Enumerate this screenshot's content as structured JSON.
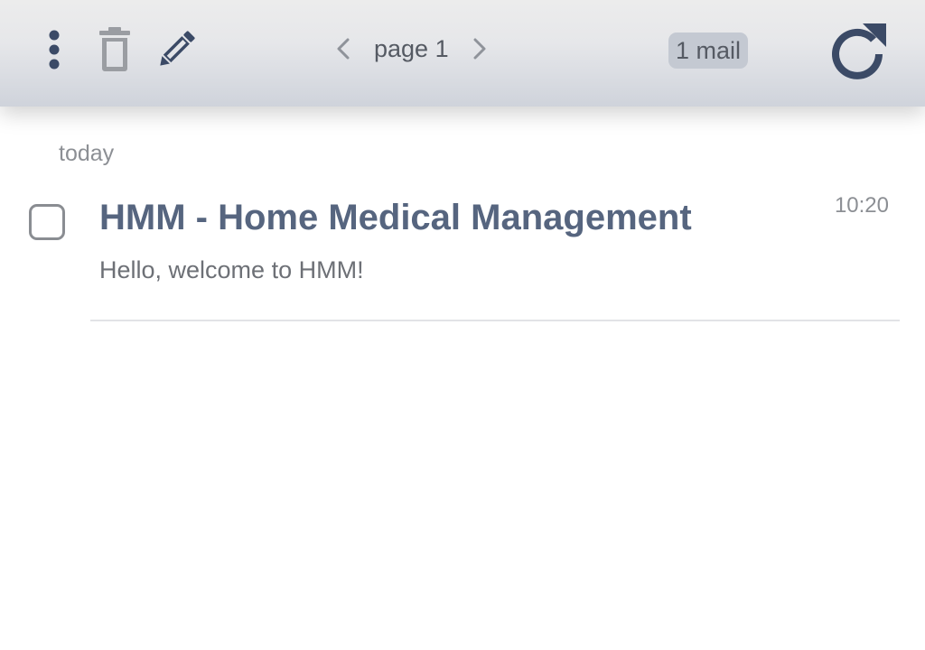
{
  "toolbar": {
    "icons": {
      "menu": "more-vertical-icon",
      "trash": "trash-icon",
      "edit": "pencil-icon",
      "prev": "chevron-left-icon",
      "next": "chevron-right-icon",
      "refresh": "refresh-icon"
    },
    "page_label": "page 1",
    "mail_count": "1 mail"
  },
  "colors": {
    "accent": "#3b4a66",
    "disabled_icon": "#9a9da2",
    "sender_text": "#56657f"
  },
  "mail_list": {
    "groups": [
      {
        "date_label": "today",
        "items": [
          {
            "sender": "HMM - Home Medical Management",
            "preview": "Hello, welcome to HMM!",
            "time": "10:20",
            "checked": false
          }
        ]
      }
    ]
  }
}
